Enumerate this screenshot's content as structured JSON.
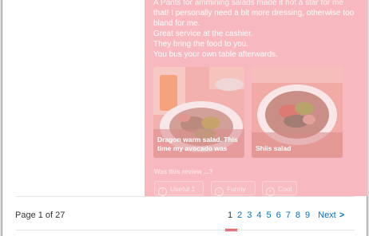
{
  "review": {
    "partial_line": "A Pants for ammining salads made it hot a star for me",
    "lines": [
      "that! I personally need a bit more dressing, otherwise too",
      "bland for me.",
      "Great service at the cashier.",
      "They bring the food to you.",
      "You bus your own table afterwards."
    ]
  },
  "photos": [
    {
      "caption": "Dragon warm salad. This time my avocado was"
    },
    {
      "caption": "Shiis salad"
    }
  ],
  "vote": {
    "prompt": "Was this review ...?",
    "useful_label": "Useful",
    "useful_count": "1",
    "funny_label": "Funny",
    "cool_label": "Cool"
  },
  "pagination": {
    "label": "Page 1 of 27",
    "pages": [
      "1",
      "2",
      "3",
      "4",
      "5",
      "6",
      "7",
      "8",
      "9"
    ],
    "current": "1",
    "next_label": "Next",
    "next_icon": "chevron-right-icon"
  },
  "colors": {
    "highlight": "#f8b8bf",
    "link": "#0073bb",
    "active_underline": "#d32323"
  }
}
